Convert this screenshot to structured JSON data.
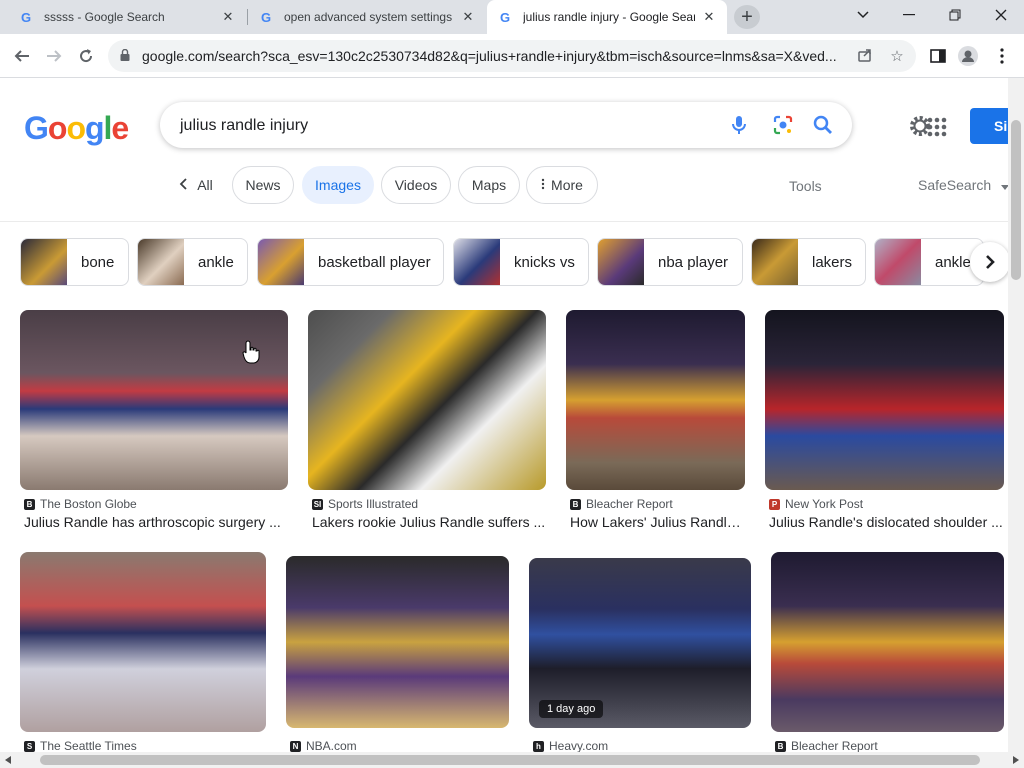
{
  "browser": {
    "tabs": [
      {
        "title": "sssss - Google Search"
      },
      {
        "title": "open advanced system settings"
      },
      {
        "title": "julius randle injury - Google Search"
      }
    ],
    "new_tab_label": "+",
    "address": "google.com/search?sca_esv=130c2c2530734d82&q=julius+randle+injury&tbm=isch&source=lnms&sa=X&ved..."
  },
  "google": {
    "query": "julius randle injury",
    "signin_label": "Si",
    "filters": [
      {
        "label": "All",
        "active": false
      },
      {
        "label": "News",
        "active": false
      },
      {
        "label": "Images",
        "active": true
      },
      {
        "label": "Videos",
        "active": false
      },
      {
        "label": "Maps",
        "active": false
      },
      {
        "label": "More",
        "active": false
      }
    ],
    "tools_label": "Tools",
    "safesearch_label": "SafeSearch"
  },
  "related": [
    {
      "label": "bone",
      "color": "#5a4a7a"
    },
    {
      "label": "ankle",
      "color": "#8a6b52"
    },
    {
      "label": "basketball player",
      "color": "#6c4aa0"
    },
    {
      "label": "knicks vs",
      "color": "#4a5a8a"
    },
    {
      "label": "nba player",
      "color": "#d79a2a"
    },
    {
      "label": "lakers",
      "color": "#7a6230"
    },
    {
      "label": "ankle",
      "color": "#8a8aa0"
    }
  ],
  "results": [
    {
      "source": "The Boston Globe",
      "title": "Julius Randle has arthroscopic surgery ...",
      "colors": [
        "#3a3140",
        "#b8434a",
        "#2a2a55"
      ]
    },
    {
      "source": "Sports Illustrated",
      "title": "Lakers rookie Julius Randle suffers ...",
      "colors": [
        "#5b5b5b",
        "#e4b022",
        "#3a3a3a"
      ]
    },
    {
      "source": "Bleacher Report",
      "title": "How Lakers' Julius Randle ...",
      "colors": [
        "#2b2440",
        "#c99a35",
        "#6b4b2a"
      ]
    },
    {
      "source": "New York Post",
      "title": "Julius Randle's dislocated shoulder ...",
      "colors": [
        "#1e1e30",
        "#b7252a",
        "#2a4aa0"
      ]
    },
    {
      "source": "The Seattle Times",
      "title": "",
      "colors": [
        "#c74a4a",
        "#2a3060",
        "#b0b0c0"
      ]
    },
    {
      "source": "NBA.com",
      "title": "",
      "colors": [
        "#5a3a7a",
        "#caa540",
        "#2a2a2a"
      ]
    },
    {
      "source": "Heavy.com",
      "title": "",
      "colors": [
        "#2a2a3a",
        "#3050a0",
        "#b03030"
      ],
      "badge": "1 day ago"
    },
    {
      "source": "Bleacher Report",
      "title": "",
      "colors": [
        "#2a2240",
        "#c99a35",
        "#3a2a5a"
      ]
    }
  ]
}
